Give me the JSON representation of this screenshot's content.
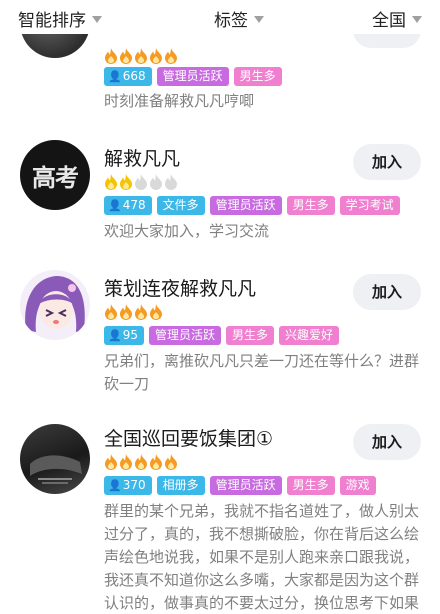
{
  "filters": {
    "sort": "智能排序",
    "tag": "标签",
    "region": "全国"
  },
  "colors": {
    "count_tag": "#3bb7e8",
    "admin_tag": "#c86be0",
    "pink_tag": "#f07fd0",
    "flame_active": "#f59a23",
    "flame_gold": "#f5c400",
    "flame_inactive": "#d9d9d9",
    "join_bg": "#eff0f4"
  },
  "groups": [
    {
      "name": "",
      "level_icons": [
        "flame-orange",
        "flame-orange",
        "flame-orange",
        "flame-orange",
        "flame-orange"
      ],
      "count": "668",
      "tags": [
        {
          "label": "管理员活跃",
          "style": "purple"
        },
        {
          "label": "男生多",
          "style": "pink"
        }
      ],
      "description": "时刻准备解救凡凡哼唧",
      "join_label": ""
    },
    {
      "name": "解救凡凡",
      "avatar_text": "高考",
      "level_icons": [
        "flame-gold",
        "flame-gold",
        "flame-gray",
        "flame-gray",
        "flame-gray"
      ],
      "count": "478",
      "tags": [
        {
          "label": "文件多",
          "style": "teal"
        },
        {
          "label": "管理员活跃",
          "style": "purple"
        },
        {
          "label": "男生多",
          "style": "pink"
        },
        {
          "label": "学习考试",
          "style": "pink"
        }
      ],
      "description": "欢迎大家加入，学习交流",
      "join_label": "加入"
    },
    {
      "name": "策划连夜解救凡凡",
      "level_icons": [
        "flame-orange",
        "flame-orange",
        "flame-orange",
        "flame-orange"
      ],
      "count": "95",
      "tags": [
        {
          "label": "管理员活跃",
          "style": "purple"
        },
        {
          "label": "男生多",
          "style": "pink"
        },
        {
          "label": "兴趣爱好",
          "style": "pink"
        }
      ],
      "description": "兄弟们，离推砍凡凡只差一刀还在等什么？进群砍一刀",
      "join_label": "加入"
    },
    {
      "name": "全国巡回要饭集团①",
      "level_icons": [
        "flame-orange",
        "flame-orange",
        "flame-orange",
        "flame-orange",
        "flame-orange"
      ],
      "count": "370",
      "tags": [
        {
          "label": "相册多",
          "style": "teal"
        },
        {
          "label": "管理员活跃",
          "style": "purple"
        },
        {
          "label": "男生多",
          "style": "pink"
        },
        {
          "label": "游戏",
          "style": "pink"
        }
      ],
      "description": "群里的某个兄弟，我就不指名道姓了，做人别太过分了，真的，我不想撕破脸，你在背后这么绘声绘色地说我，如果不是别人跑来亲口跟我说，我还真不知道你这么多嘴，大家都是因为这个群认识的，做事真的不要太过分，换位思考下如果我也这么说你你会怎么想，还会无",
      "join_label": "加入"
    }
  ]
}
